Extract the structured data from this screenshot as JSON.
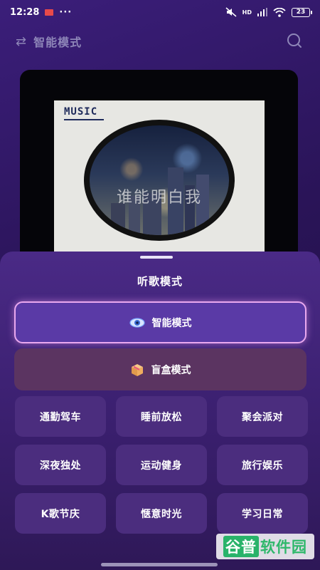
{
  "status_bar": {
    "time": "12:28",
    "dots": "···",
    "network": "HD",
    "battery": "23",
    "icons": [
      "notification-app-icon",
      "mute-icon",
      "signal-icon",
      "wifi-icon",
      "battery-icon"
    ]
  },
  "header": {
    "title": "智能模式",
    "switch_icon": "switch-arrows-icon",
    "search_icon": "search-icon"
  },
  "album": {
    "label": "MUSIC",
    "overlay_text": "谁能明白我"
  },
  "sheet": {
    "title": "听歌模式",
    "smart_mode": {
      "label": "智能模式",
      "icon": "eye-icon",
      "selected": true
    },
    "blind_mode": {
      "label": "盲盒模式",
      "icon": "gift-box-icon"
    },
    "scenes": [
      "通勤驾车",
      "睡前放松",
      "聚会派对",
      "深夜独处",
      "运动健身",
      "旅行娱乐",
      "K歌节庆",
      "惬意时光",
      "学习日常"
    ]
  },
  "watermark": {
    "prefix": "谷普",
    "text": "软件园"
  },
  "colors": {
    "accent_border": "#e9a8ee",
    "smart_button": "#5a3aa6",
    "blind_button": "#5b3461",
    "scene_button": "#4b2d7e",
    "watermark_green": "#2fb86b"
  }
}
